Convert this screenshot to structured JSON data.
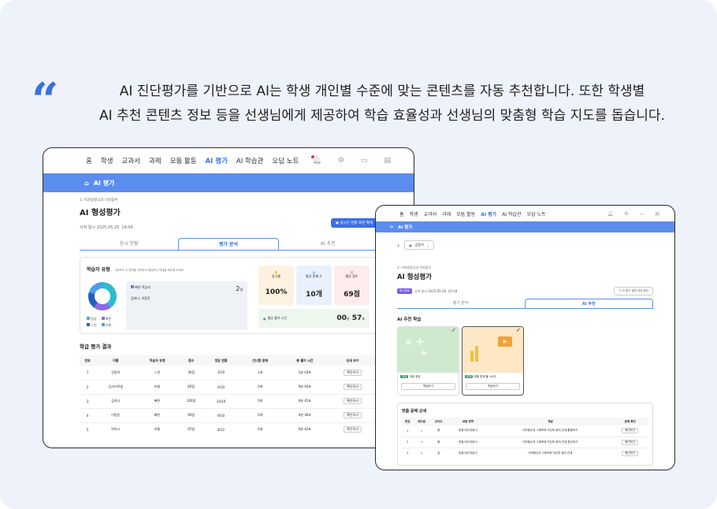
{
  "headline": {
    "line1": "AI 진단평가를 기반으로 AI는 학생 개인별 수준에 맞는 콘텐츠를 자동 추천합니다. 또한 학생별",
    "line2": "AI 추천 콘텐츠 정보 등을 선생님에게 제공하여 학습 효율성과 선생님의 맞춤형 학습 지도를 돕습니다."
  },
  "nav": [
    "홈",
    "학생",
    "교과서",
    "과제",
    "모둠 활동",
    "AI 평가",
    "AI 학습관",
    "오답 노트"
  ],
  "bar_label": "AI 평가",
  "w1": {
    "breadcrumb": "3. 이차방정식과 이차함수",
    "title": "AI 형성평가",
    "start": "시작 일시 2025.05.25. 14:06",
    "live_btn": "실시간 현황 화면 확대",
    "tabs": [
      "응시 현황",
      "평가 분석",
      "AI 추천"
    ],
    "type_title": "학습자 유형",
    "type_desc": "그래프의 각 영역을 선택하여 해당하는 학생을 확인해 보세요",
    "legend": [
      "정상",
      "빠른",
      "느린",
      "보통"
    ],
    "selected_type": "빠른 학습자",
    "selected_count": "2",
    "count_unit": "명",
    "selected_names": "김하나, 이동준",
    "stats": [
      {
        "label": "응시율",
        "value": "100%"
      },
      {
        "label": "평균 문제 수",
        "value": "10개"
      },
      {
        "label": "평균 점수",
        "value": "69점"
      }
    ],
    "avg_time_label": "평균 풀이 시간",
    "avg_time_min": "00",
    "avg_time_min_unit": "분",
    "avg_time_sec": "57",
    "avg_time_sec_unit": "초",
    "result_title": "학급 평가 결과",
    "columns": [
      "번호",
      "이름",
      "학습자 유형",
      "점수",
      "정답 현황",
      "건너뛴 문제",
      "총 풀이 시간",
      "상세 보기"
    ],
    "rows": [
      [
        "1",
        "강동이",
        "느린",
        "30점",
        "3/10",
        "1개",
        "1분 03초",
        "확인하기"
      ],
      [
        "2",
        "김사이로빛",
        "보통",
        "60점",
        "6/10",
        "0개",
        "0분 40초",
        "확인하기"
      ],
      [
        "3",
        "김하나",
        "빠른",
        "100점",
        "10/10",
        "0개",
        "0분 45초",
        "확인하기"
      ],
      [
        "4",
        "이동준",
        "빠른",
        "90점",
        "9/10",
        "0개",
        "0분 36초",
        "확인하기"
      ],
      [
        "5",
        "박하나",
        "보통",
        "67점",
        "8/12",
        "0개",
        "0분 42초",
        "확인하기"
      ]
    ]
  },
  "w2": {
    "student": "김동이",
    "breadcrumb": "3. 이차방정식과 이차함수",
    "title": "AI 형성평가",
    "badge": "응시완료",
    "start": "시작 일시 2025.05.26. 10:18",
    "btn": "AI 평가 결과 대상 확인",
    "tabs": [
      "평가 분석",
      "AI 추천"
    ],
    "rec_title": "AI 추천 학습",
    "cards": [
      {
        "tag": "개념",
        "name": "개념 영상",
        "btn": "학습하기"
      },
      {
        "tag": "문제",
        "name": "맞춤 문제 풀 10개",
        "btn": "학습하기"
      }
    ],
    "detail_title": "맞춤 문제 상세",
    "columns": [
      "번호",
      "정오답",
      "난이도",
      "내용 영역",
      "개념",
      "문제 확인"
    ],
    "rows": [
      [
        "1",
        "x",
        "중",
        "방정식과 부등식",
        "이차함수의 그래프와 직선의 위치 관계 활용하기",
        "확인하기"
      ],
      [
        "2",
        "x",
        "중",
        "방정식과 부등식",
        "이차함수의 그래프와 직선의 위치 관계 판단하기",
        "확인하기"
      ],
      [
        "3",
        "o",
        "상",
        "방정식과 부등식",
        "이차함수의 그래프와 직선의 위치 관계",
        "확인하기"
      ]
    ]
  }
}
